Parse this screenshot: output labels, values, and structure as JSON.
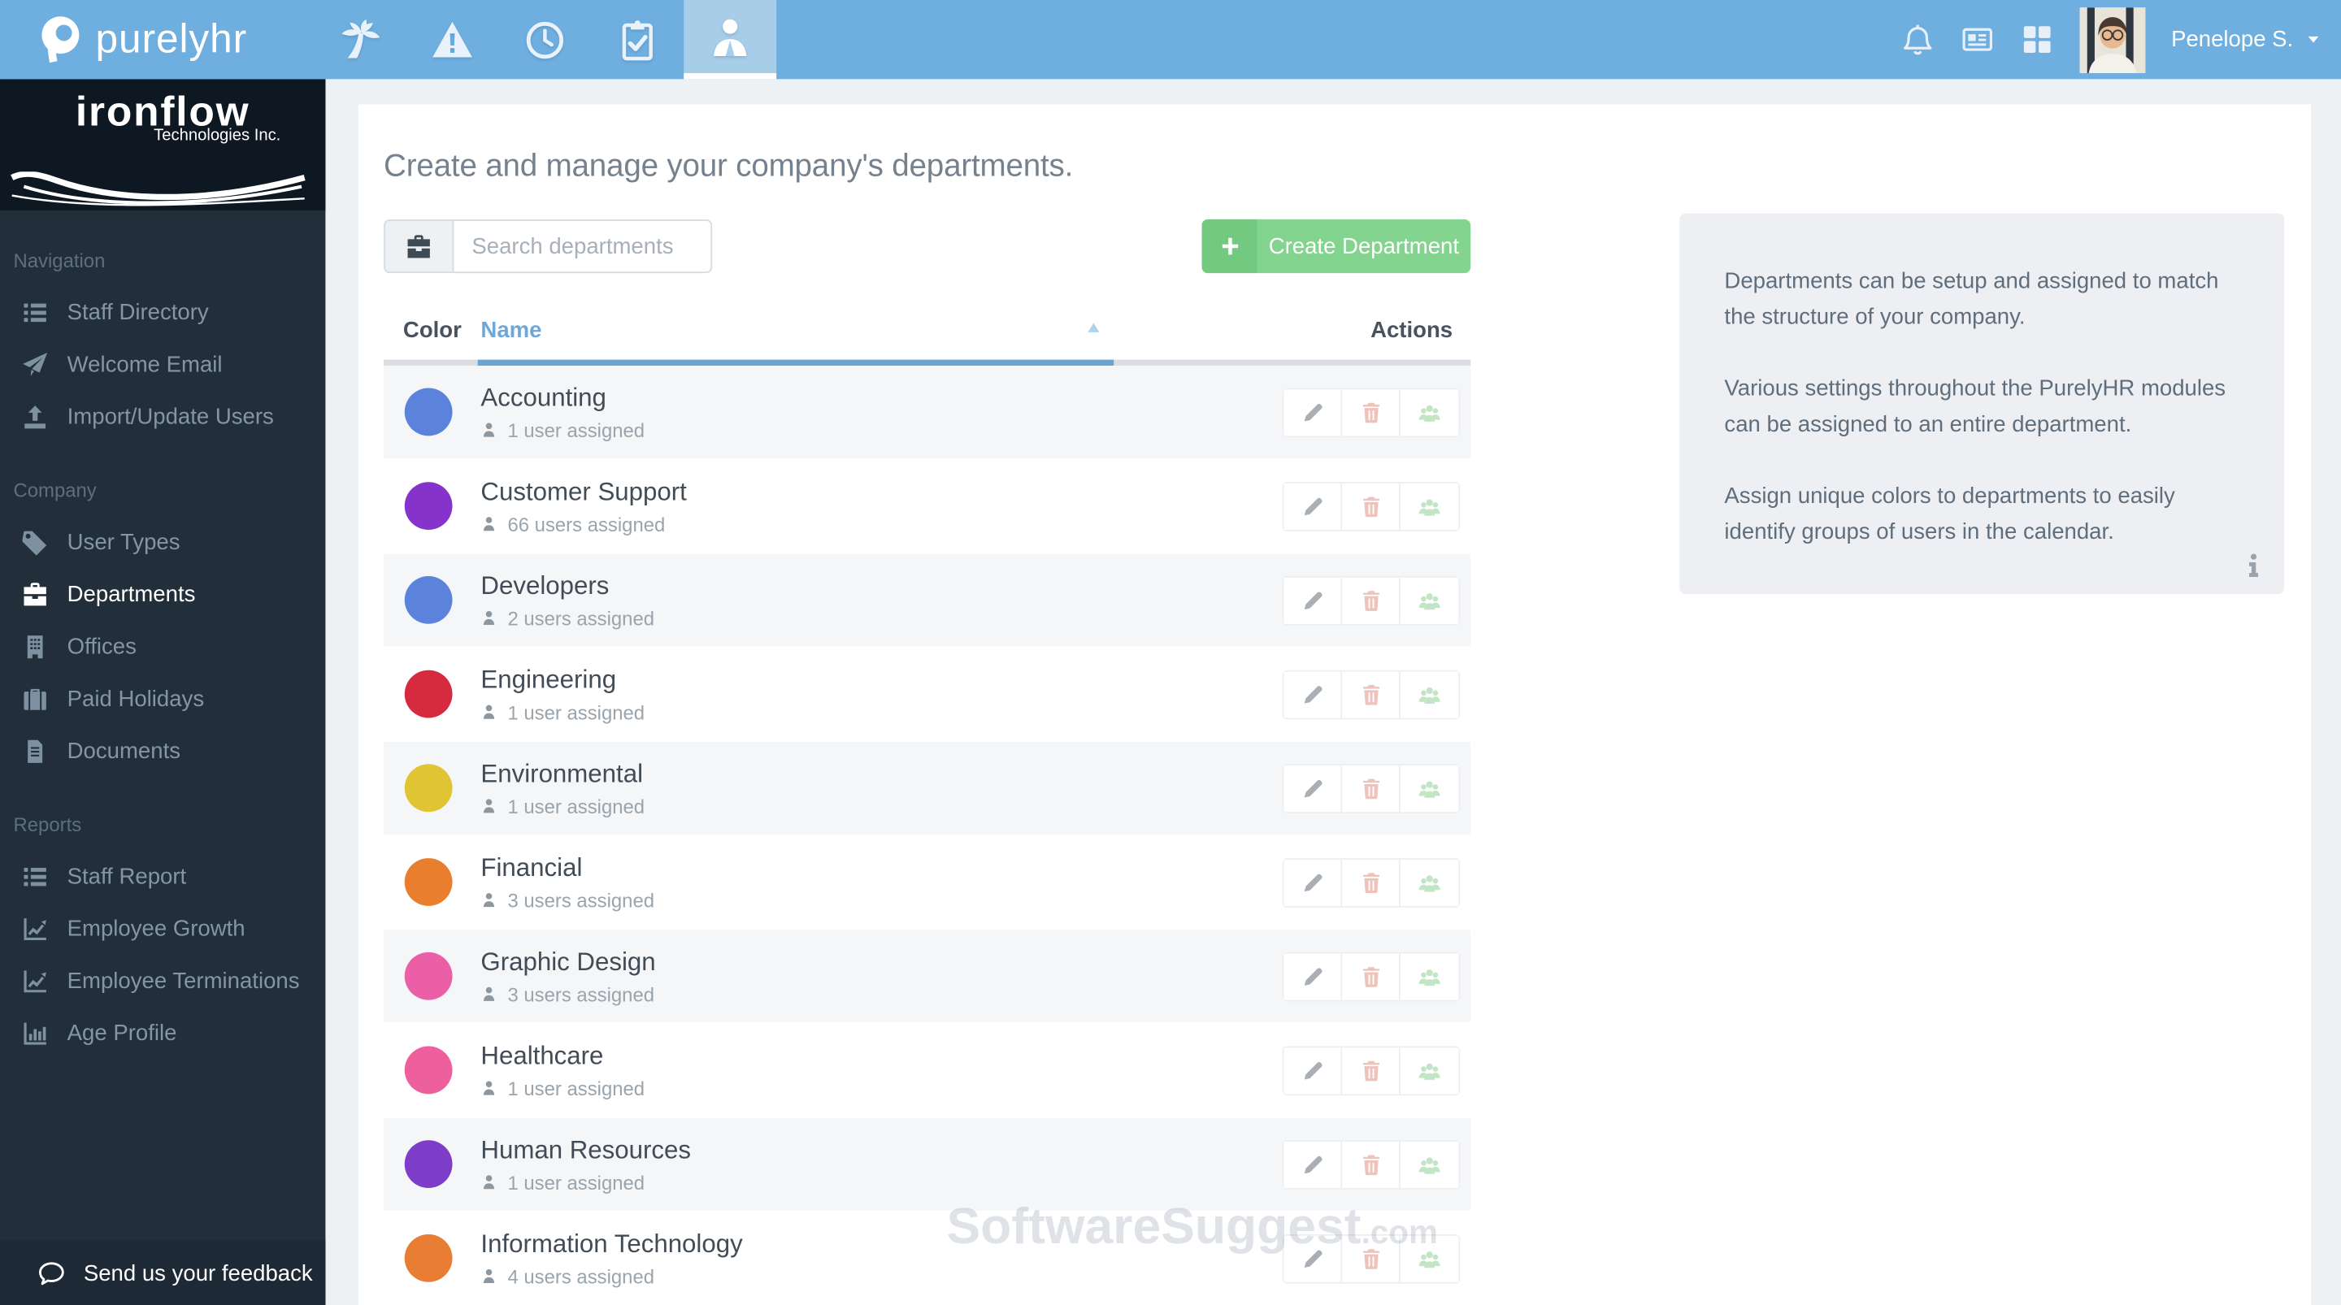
{
  "topbar": {
    "brand": "purelyhr",
    "tabs": [
      {
        "icon": "palm-tree-icon"
      },
      {
        "icon": "warning-triangle-icon"
      },
      {
        "icon": "clock-icon"
      },
      {
        "icon": "clipboard-check-icon"
      },
      {
        "icon": "person-suit-icon",
        "active": true
      }
    ],
    "right_icons": [
      "bell-icon",
      "newspaper-icon",
      "grid-icon"
    ],
    "user_name": "Penelope S."
  },
  "sidebar": {
    "logo": {
      "line1": "ironflow",
      "line2": "Technologies Inc."
    },
    "sections": [
      {
        "label": "Navigation",
        "items": [
          {
            "label": "Staff Directory",
            "icon": "list-icon"
          },
          {
            "label": "Welcome Email",
            "icon": "paper-plane-icon"
          },
          {
            "label": "Import/Update Users",
            "icon": "upload-icon"
          }
        ]
      },
      {
        "label": "Company",
        "items": [
          {
            "label": "User Types",
            "icon": "tag-icon"
          },
          {
            "label": "Departments",
            "icon": "briefcase-icon",
            "active": true
          },
          {
            "label": "Offices",
            "icon": "building-icon"
          },
          {
            "label": "Paid Holidays",
            "icon": "suitcase-icon"
          },
          {
            "label": "Documents",
            "icon": "document-icon"
          }
        ]
      },
      {
        "label": "Reports",
        "items": [
          {
            "label": "Staff Report",
            "icon": "list-icon"
          },
          {
            "label": "Employee Growth",
            "icon": "line-chart-icon"
          },
          {
            "label": "Employee Terminations",
            "icon": "line-chart-icon"
          },
          {
            "label": "Age Profile",
            "icon": "bar-chart-icon"
          }
        ]
      }
    ],
    "feedback_label": "Send us your feedback"
  },
  "main": {
    "heading": "Create and manage your company's departments.",
    "search": {
      "placeholder": "Search departments",
      "icon": "briefcase-icon"
    },
    "create_label": "Create Department",
    "table": {
      "headers": {
        "color": "Color",
        "name": "Name",
        "actions": "Actions"
      },
      "sort": "ascending",
      "rows": [
        {
          "name": "Accounting",
          "users": "1 user assigned",
          "color": "#5b83db"
        },
        {
          "name": "Customer Support",
          "users": "66 users assigned",
          "color": "#8633cc"
        },
        {
          "name": "Developers",
          "users": "2 users assigned",
          "color": "#5b83db"
        },
        {
          "name": "Engineering",
          "users": "1 user assigned",
          "color": "#d62b3e"
        },
        {
          "name": "Environmental",
          "users": "1 user assigned",
          "color": "#e0c433"
        },
        {
          "name": "Financial",
          "users": "3 users assigned",
          "color": "#e87e2e"
        },
        {
          "name": "Graphic Design",
          "users": "3 users assigned",
          "color": "#ea5fa5"
        },
        {
          "name": "Healthcare",
          "users": "1 user assigned",
          "color": "#ee5f9e"
        },
        {
          "name": "Human Resources",
          "users": "1 user assigned",
          "color": "#7e3dc8"
        },
        {
          "name": "Information Technology",
          "users": "4 users assigned",
          "color": "#e87e33"
        }
      ]
    },
    "info_panel": {
      "paragraphs": [
        "Departments can be setup and assigned to match the structure of your company.",
        "Various settings throughout the PurelyHR modules can be assigned to an entire department.",
        "Assign unique colors to departments to easily identify groups of users in the calendar."
      ]
    },
    "watermark": {
      "main": "SoftwareSuggest",
      "suffix": ".com"
    }
  },
  "colors": {
    "topbar": "#6fafe0",
    "topbar_active_tab": "#a8cde9",
    "sidebar": "#222f3a",
    "sidebar_logo_box": "#0e1823",
    "accent_blue": "#68a4d4",
    "create_button_green": "#83d48f"
  }
}
